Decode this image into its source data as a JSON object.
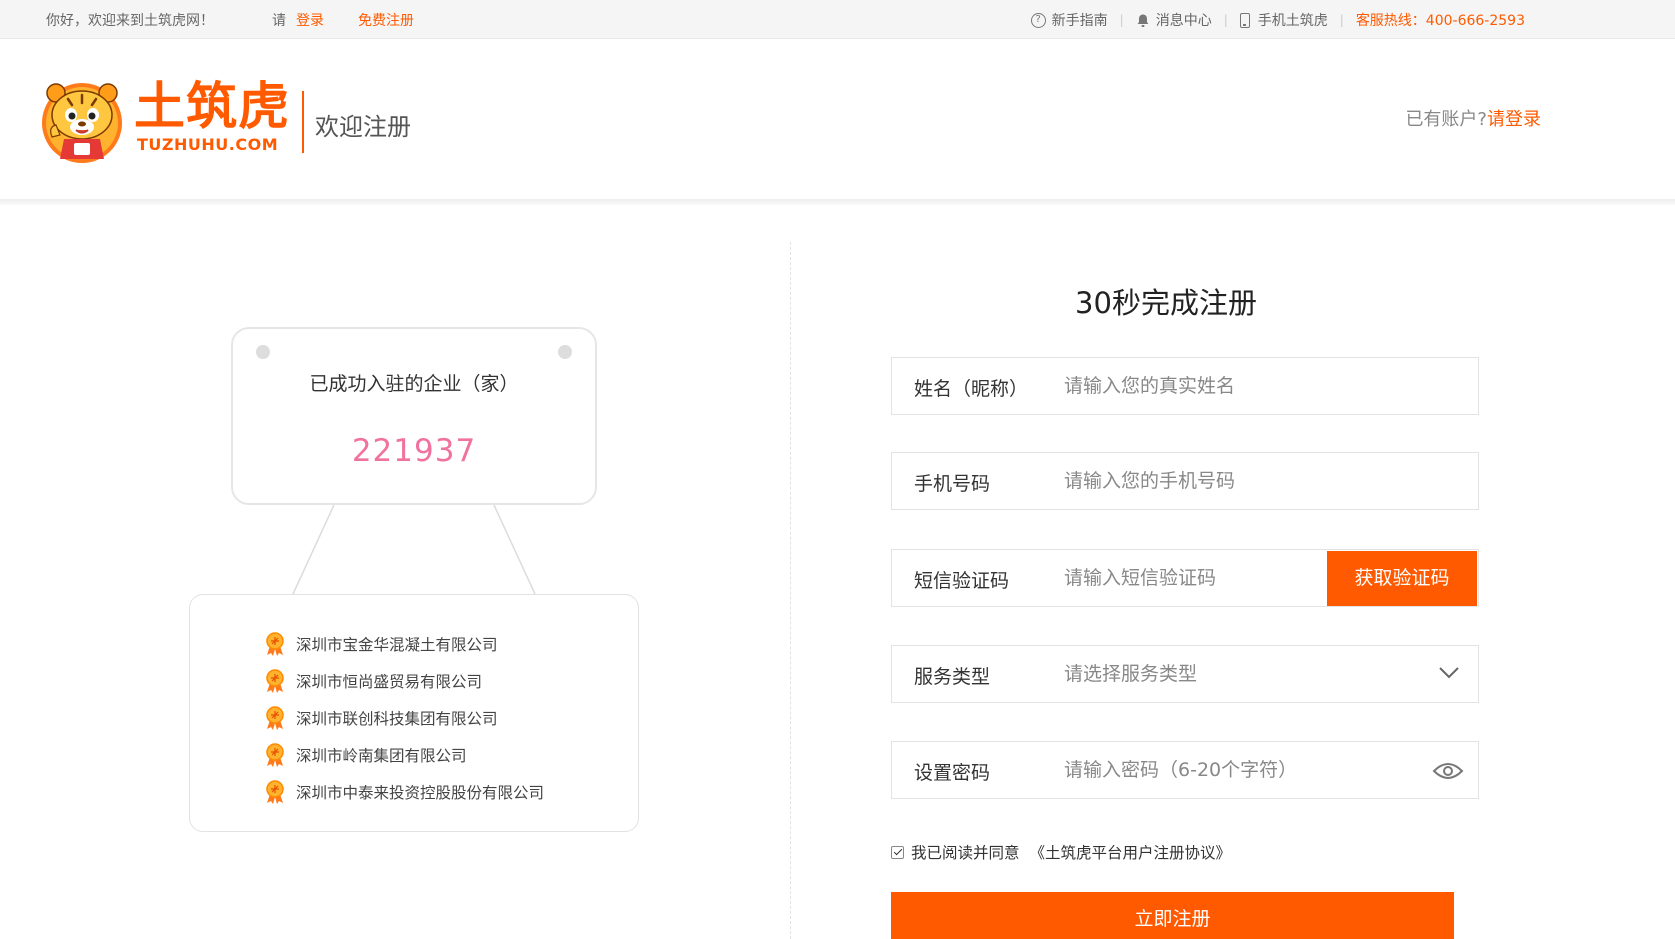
{
  "topbar": {
    "greeting": "你好，欢迎来到土筑虎网！",
    "please": "请",
    "login": "登录",
    "register": "免费注册",
    "guide": "新手指南",
    "messages": "消息中心",
    "mobile": "手机土筑虎",
    "hotline": "客服热线：400-666-2593"
  },
  "header": {
    "logo_text": "土筑虎",
    "logo_sub": "TUZHUHU.COM",
    "title": "欢迎注册",
    "have_account": "已有账户?",
    "login_link": "请登录"
  },
  "stats": {
    "label": "已成功入驻的企业（家）",
    "count": "221937",
    "companies": [
      "深圳市宝金华混凝土有限公司",
      "深圳市恒尚盛贸易有限公司",
      "深圳市联创科技集团有限公司",
      "深圳市岭南集团有限公司",
      "深圳市中泰来投资控股股份有限公司"
    ]
  },
  "form": {
    "title": "30秒完成注册",
    "name_label": "姓名（昵称）",
    "name_placeholder": "请输入您的真实姓名",
    "phone_label": "手机号码",
    "phone_placeholder": "请输入您的手机号码",
    "sms_label": "短信验证码",
    "sms_placeholder": "请输入短信验证码",
    "sms_button": "获取验证码",
    "service_label": "服务类型",
    "service_placeholder": "请选择服务类型",
    "password_label": "设置密码",
    "password_placeholder": "请输入密码（6-20个字符）",
    "agree_text": "我已阅读并同意",
    "agree_link": "《土筑虎平台用户注册协议》",
    "agree_checked": true,
    "submit": "立即注册"
  },
  "colors": {
    "brand": "#ff5a00",
    "count": "#f0739f"
  },
  "icons": [
    "question-icon",
    "bell-icon",
    "phone-icon",
    "tiger-mascot-logo",
    "medal-icon",
    "chevron-down-icon",
    "eye-icon"
  ]
}
